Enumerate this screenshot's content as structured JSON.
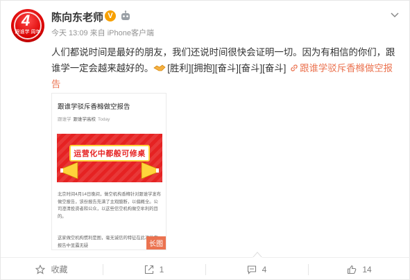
{
  "user": {
    "name": "陈向东老师",
    "avatar_text_big": "4",
    "avatar_text_small": "跟谁学 周年",
    "verified_mark": "V"
  },
  "meta": {
    "time": "今天 13:09",
    "source": "来自 iPhone客户端"
  },
  "post": {
    "text": "人们都说时间是最好的朋友，我们还说时间很快会证明一切。因为有相信的你们，跟谁学一定会越来越好的。",
    "emoticons": "[胜利][拥抱][奋斗][奋斗][奋斗]",
    "link_text": "跟谁学驳斥香橼做空报告"
  },
  "long_image": {
    "title": "跟谁学驳斥香橼做空报告",
    "source_prefix": "跟谁学",
    "account": "跟谁学高校",
    "time_tag": "Today",
    "slogan": "运营化中都般可修桌",
    "para1": "北京时间4月14日晚间，做空机构香橼针对跟谁学发布做空报告，该份报告充满了主观臆断，以偏概全。公司澄清投资者和公众，以这些信空机构做空牟利的目的。",
    "para2": "这家做空机构惯利是图，毫无诚信的特征在此次做空报告中显露无疑",
    "tag": "长图"
  },
  "actions": {
    "collect": "收藏",
    "repost": "1",
    "comment": "4",
    "like": "14"
  },
  "colors": {
    "accent": "#eb7350",
    "banner_red": "#e62222",
    "verified": "#f7a000"
  },
  "icons": [
    "chevron-down-icon",
    "robot-icon",
    "handshake-icon",
    "link-icon",
    "star-icon",
    "repost-icon",
    "comment-icon",
    "like-icon",
    "megaphone-icon"
  ]
}
